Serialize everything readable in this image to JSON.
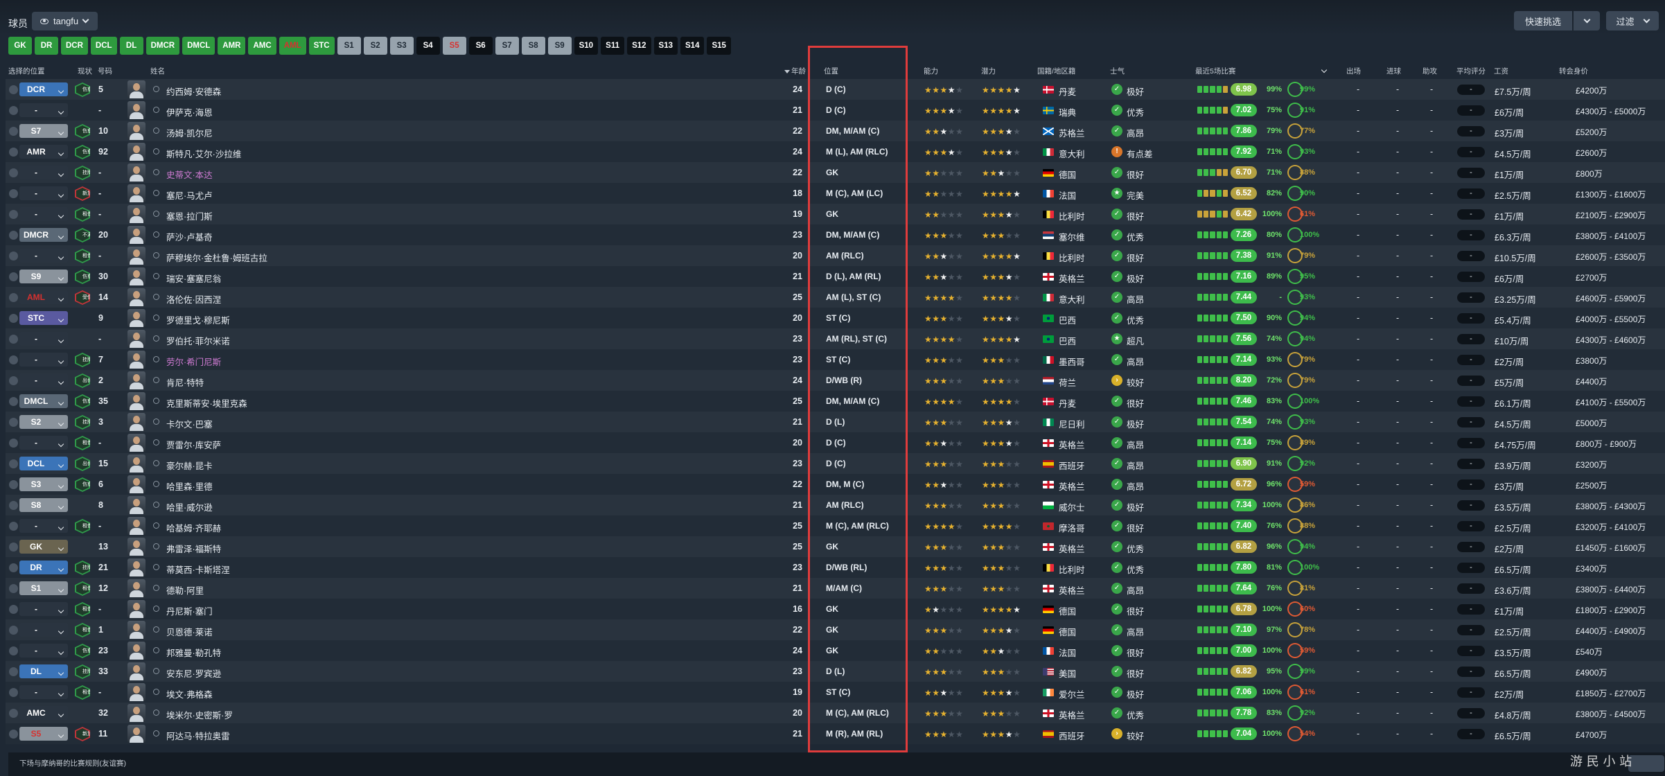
{
  "header": {
    "title": "球员",
    "view_name": "tangfu",
    "quick_pick": "快速挑选",
    "filter": "过滤"
  },
  "position_tabs": [
    {
      "label": "GK",
      "style": "g"
    },
    {
      "label": "DR",
      "style": "g"
    },
    {
      "label": "DCR",
      "style": "g"
    },
    {
      "label": "DCL",
      "style": "g"
    },
    {
      "label": "DL",
      "style": "g"
    },
    {
      "label": "DMCR",
      "style": "g"
    },
    {
      "label": "DMCL",
      "style": "g"
    },
    {
      "label": "AMR",
      "style": "g"
    },
    {
      "label": "AMC",
      "style": "g"
    },
    {
      "label": "AML",
      "style": "g"
    },
    {
      "label": "STC",
      "style": "g"
    },
    {
      "label": "S1",
      "style": "l"
    },
    {
      "label": "S2",
      "style": "l"
    },
    {
      "label": "S3",
      "style": "l"
    },
    {
      "label": "S4",
      "style": "d"
    },
    {
      "label": "S5",
      "style": "l"
    },
    {
      "label": "S6",
      "style": "d"
    },
    {
      "label": "S7",
      "style": "l"
    },
    {
      "label": "S8",
      "style": "l"
    },
    {
      "label": "S9",
      "style": "l"
    },
    {
      "label": "S10",
      "style": "d"
    },
    {
      "label": "S11",
      "style": "d"
    },
    {
      "label": "S12",
      "style": "d"
    },
    {
      "label": "S13",
      "style": "d"
    },
    {
      "label": "S14",
      "style": "d"
    },
    {
      "label": "S15",
      "style": "d"
    }
  ],
  "columns": {
    "selected_position": "选择的位置",
    "status": "现状",
    "number": "号码",
    "name": "姓名",
    "age": "年龄",
    "position": "位置",
    "ability": "能力",
    "potential": "潜力",
    "nation": "国籍/地区籍",
    "morale": "士气",
    "last5": "最近5场比赛",
    "appearances": "出场",
    "goals": "进球",
    "assists": "助攻",
    "avg_rating": "平均评分",
    "wage": "工资",
    "value": "转会身价"
  },
  "players": [
    {
      "sel": "DCR",
      "selColor": "#3b74b8",
      "status": "伤愈",
      "statusType": "green",
      "no": "5",
      "name": "约西姆·安德森",
      "age": "24",
      "pos": "D (C)",
      "ca": 3.5,
      "pa": 4.5,
      "flag": "dk",
      "nation": "丹麦",
      "mIcon": "✓",
      "mColor": "#3aa74a",
      "morale": "极好",
      "rating": "6.98",
      "rColor": "#7fc44b",
      "form": "gggga",
      "fit": "99%",
      "cond": "99%",
      "wage": "£7.5万/周",
      "value": "£4200万"
    },
    {
      "sel": "-",
      "selColor": "#2a3440",
      "status": "",
      "statusType": "none",
      "no": "-",
      "name": "伊萨克·海恩",
      "age": "21",
      "pos": "D (C)",
      "ca": 3.5,
      "pa": 4.5,
      "flag": "se",
      "nation": "瑞典",
      "mIcon": "✓",
      "mColor": "#3aa74a",
      "morale": "优秀",
      "rating": "7.02",
      "rColor": "#3dbb4c",
      "form": "gggga",
      "fit": "75%",
      "cond": "91%",
      "wage": "£6万/周",
      "value": "£4300万 - £5000万"
    },
    {
      "sel": "S7",
      "selColor": "#8a939c",
      "status": "伤愈",
      "statusType": "green",
      "no": "10",
      "name": "汤姆·凯尔尼",
      "age": "22",
      "pos": "DM, M/AM (C)",
      "ca": 2.5,
      "pa": 3.5,
      "flag": "sc",
      "nation": "苏格兰",
      "mIcon": "✓",
      "mColor": "#3aa74a",
      "morale": "高昂",
      "rating": "7.86",
      "rColor": "#3dbb4c",
      "form": "ggggg",
      "fit": "79%",
      "cond": "77%",
      "wage": "£3万/周",
      "value": "£5200万"
    },
    {
      "sel": "AMR",
      "selColor": "#2a3440",
      "status": "伤愈",
      "statusType": "green",
      "no": "92",
      "name": "斯特凡·艾尔·沙拉维",
      "age": "24",
      "pos": "M (L), AM (RLC)",
      "ca": 3.5,
      "pa": 3.5,
      "flag": "it",
      "nation": "意大利",
      "mIcon": "!",
      "mColor": "#d9762a",
      "morale": "有点差",
      "rating": "7.92",
      "rColor": "#3dbb4c",
      "form": "ggggg",
      "fit": "71%",
      "cond": "93%",
      "wage": "£4.5万/周",
      "value": "£2600万"
    },
    {
      "sel": "-",
      "selColor": "#2a3440",
      "status": "挂牌",
      "statusType": "green",
      "no": "-",
      "name": "史蒂文·本达",
      "age": "22",
      "pos": "GK",
      "ca": 2,
      "pa": 2.5,
      "flag": "de",
      "nation": "德国",
      "mIcon": "✓",
      "mColor": "#3aa74a",
      "morale": "很好",
      "rating": "6.70",
      "rColor": "#b3a042",
      "form": "gggaa",
      "fit": "71%",
      "cond": "88%",
      "wage": "£1万/周",
      "value": "£800万",
      "pink": true
    },
    {
      "sel": "-",
      "selColor": "#2a3440",
      "status": "新加入",
      "statusType": "red",
      "no": "-",
      "name": "塞尼·马尤卢",
      "age": "18",
      "pos": "M (C), AM (LC)",
      "ca": 2,
      "pa": 4.5,
      "flag": "fr",
      "nation": "法国",
      "mIcon": "★",
      "mColor": "#3aa74a",
      "morale": "完美",
      "rating": "6.52",
      "rColor": "#b3a042",
      "form": "gaaga",
      "fit": "82%",
      "cond": "90%",
      "wage": "£2.5万/周",
      "value": "£1300万 - £1600万"
    },
    {
      "sel": "-",
      "selColor": "#2a3440",
      "status": "租借",
      "statusType": "green",
      "no": "-",
      "name": "塞恩·拉门斯",
      "age": "19",
      "pos": "GK",
      "ca": 2,
      "pa": 3.5,
      "flag": "be",
      "nation": "比利时",
      "mIcon": "✓",
      "mColor": "#3aa74a",
      "morale": "很好",
      "rating": "6.42",
      "rColor": "#b3a042",
      "form": "aaaga",
      "fit": "100%",
      "cond": "61%",
      "wage": "£1万/周",
      "value": "£2100万 - £2900万"
    },
    {
      "sel": "DMCR",
      "selColor": "#5a6876",
      "status": "不满",
      "statusType": "green",
      "no": "20",
      "name": "萨沙·卢基奇",
      "age": "23",
      "pos": "DM, M/AM (C)",
      "ca": 3,
      "pa": 3,
      "flag": "rs",
      "nation": "塞尔维",
      "mIcon": "✓",
      "mColor": "#3aa74a",
      "morale": "优秀",
      "rating": "7.26",
      "rColor": "#3dbb4c",
      "form": "ggggg",
      "fit": "80%",
      "cond": "100%",
      "wage": "£6.3万/周",
      "value": "£3800万 - £4100万"
    },
    {
      "sel": "-",
      "selColor": "#2a3440",
      "status": "租借",
      "statusType": "green",
      "no": "-",
      "name": "萨穆埃尔·金杜鲁·姆班古拉",
      "age": "20",
      "pos": "AM (RLC)",
      "ca": 2.5,
      "pa": 4.5,
      "flag": "be",
      "nation": "比利时",
      "mIcon": "✓",
      "mColor": "#3aa74a",
      "morale": "很好",
      "rating": "7.38",
      "rColor": "#3dbb4c",
      "form": "ggggg",
      "fit": "91%",
      "cond": "79%",
      "wage": "£10.5万/周",
      "value": "£2600万 - £3500万"
    },
    {
      "sel": "S9",
      "selColor": "#8a939c",
      "status": "伤愈",
      "statusType": "green",
      "no": "30",
      "name": "瑞安·塞塞尼翁",
      "age": "21",
      "pos": "D (L), AM (RL)",
      "ca": 2.5,
      "pa": 3.5,
      "flag": "en",
      "nation": "英格兰",
      "mIcon": "✓",
      "mColor": "#3aa74a",
      "morale": "极好",
      "rating": "7.16",
      "rColor": "#3dbb4c",
      "form": "ggggg",
      "fit": "89%",
      "cond": "95%",
      "wage": "£6万/周",
      "value": "£2700万"
    },
    {
      "sel": "AML",
      "selColor": "#2a3440",
      "status": "受伤",
      "statusType": "red",
      "no": "14",
      "name": "洛伦佐·因西涅",
      "age": "25",
      "pos": "AM (L), ST (C)",
      "ca": 4,
      "pa": 4,
      "flag": "it",
      "nation": "意大利",
      "mIcon": "✓",
      "mColor": "#3aa74a",
      "morale": "高昂",
      "rating": "7.44",
      "rColor": "#3dbb4c",
      "form": "ggggg",
      "fit": "-",
      "cond": "93%",
      "wage": "£3.25万/周",
      "value": "£4600万 - £5900万",
      "selRed": true
    },
    {
      "sel": "STC",
      "selColor": "#5a5aa0",
      "status": "",
      "statusType": "none",
      "no": "9",
      "name": "罗德里戈·穆尼斯",
      "age": "20",
      "pos": "ST (C)",
      "ca": 3,
      "pa": 3.5,
      "flag": "br",
      "nation": "巴西",
      "mIcon": "✓",
      "mColor": "#3aa74a",
      "morale": "优秀",
      "rating": "7.50",
      "rColor": "#3dbb4c",
      "form": "ggggg",
      "fit": "90%",
      "cond": "94%",
      "wage": "£5.4万/周",
      "value": "£4000万 - £5500万"
    },
    {
      "sel": "-",
      "selColor": "#2a3440",
      "status": "",
      "statusType": "none",
      "no": "-",
      "name": "罗伯托·菲尔米诺",
      "age": "23",
      "pos": "AM (RL), ST (C)",
      "ca": 4,
      "pa": 4.5,
      "flag": "br",
      "nation": "巴西",
      "mIcon": "★",
      "mColor": "#3aa74a",
      "morale": "超凡",
      "rating": "7.56",
      "rColor": "#3dbb4c",
      "form": "ggggg",
      "fit": "74%",
      "cond": "94%",
      "wage": "£10万/周",
      "value": "£4300万 - £4600万"
    },
    {
      "sel": "-",
      "selColor": "#2a3440",
      "status": "挂牌",
      "statusType": "green",
      "no": "7",
      "name": "劳尔·希门尼斯",
      "age": "23",
      "pos": "ST (C)",
      "ca": 3,
      "pa": 3,
      "flag": "mx",
      "nation": "墨西哥",
      "mIcon": "✓",
      "mColor": "#3aa74a",
      "morale": "高昂",
      "rating": "7.14",
      "rColor": "#3dbb4c",
      "form": "ggggg",
      "fit": "93%",
      "cond": "79%",
      "wage": "£2万/周",
      "value": "£3800万",
      "pink": true
    },
    {
      "sel": "-",
      "selColor": "#2a3440",
      "status": "出价",
      "statusType": "green",
      "no": "2",
      "name": "肯尼·特特",
      "age": "24",
      "pos": "D/WB (R)",
      "ca": 3,
      "pa": 3,
      "flag": "nl",
      "nation": "荷兰",
      "mIcon": "›",
      "mColor": "#d9b12a",
      "morale": "较好",
      "rating": "8.20",
      "rColor": "#3dbb4c",
      "form": "ggggg",
      "fit": "72%",
      "cond": "79%",
      "wage": "£5万/周",
      "value": "£4400万"
    },
    {
      "sel": "DMCL",
      "selColor": "#5a6876",
      "status": "伤愈",
      "statusType": "green",
      "no": "35",
      "name": "克里斯蒂安·埃里克森",
      "age": "25",
      "pos": "DM, M/AM (C)",
      "ca": 4,
      "pa": 4,
      "flag": "dk",
      "nation": "丹麦",
      "mIcon": "✓",
      "mColor": "#3aa74a",
      "morale": "很好",
      "rating": "7.46",
      "rColor": "#3dbb4c",
      "form": "ggggg",
      "fit": "83%",
      "cond": "100%",
      "wage": "£6.1万/周",
      "value": "£4100万 - £5500万"
    },
    {
      "sel": "S2",
      "selColor": "#8a939c",
      "status": "挂牌",
      "statusType": "green",
      "no": "3",
      "name": "卡尔文·巴塞",
      "age": "21",
      "pos": "D (L)",
      "ca": 3,
      "pa": 3.5,
      "flag": "ng",
      "nation": "尼日利",
      "mIcon": "✓",
      "mColor": "#3aa74a",
      "morale": "极好",
      "rating": "7.54",
      "rColor": "#3dbb4c",
      "form": "ggggg",
      "fit": "74%",
      "cond": "93%",
      "wage": "£4.5万/周",
      "value": "£5000万"
    },
    {
      "sel": "-",
      "selColor": "#2a3440",
      "status": "租借",
      "statusType": "green",
      "no": "-",
      "name": "贾雷尔·库安萨",
      "age": "20",
      "pos": "D (C)",
      "ca": 2.5,
      "pa": 3.5,
      "flag": "en",
      "nation": "英格兰",
      "mIcon": "✓",
      "mColor": "#3aa74a",
      "morale": "高昂",
      "rating": "7.14",
      "rColor": "#3dbb4c",
      "form": "ggggg",
      "fit": "75%",
      "cond": "89%",
      "wage": "£4.75万/周",
      "value": "£800万 - £900万"
    },
    {
      "sel": "DCL",
      "selColor": "#3b74b8",
      "status": "出价",
      "statusType": "green",
      "no": "15",
      "name": "豪尔赫·昆卡",
      "age": "23",
      "pos": "D (C)",
      "ca": 3,
      "pa": 3,
      "flag": "es",
      "nation": "西班牙",
      "mIcon": "✓",
      "mColor": "#3aa74a",
      "morale": "高昂",
      "rating": "6.90",
      "rColor": "#7fc44b",
      "form": "ggggg",
      "fit": "91%",
      "cond": "92%",
      "wage": "£3.9万/周",
      "value": "£3200万"
    },
    {
      "sel": "S3",
      "selColor": "#8a939c",
      "status": "伤愈",
      "statusType": "green",
      "no": "6",
      "name": "哈里森·里德",
      "age": "22",
      "pos": "DM, M (C)",
      "ca": 2.5,
      "pa": 3,
      "flag": "en",
      "nation": "英格兰",
      "mIcon": "✓",
      "mColor": "#3aa74a",
      "morale": "高昂",
      "rating": "6.72",
      "rColor": "#b3a042",
      "form": "ggggg",
      "fit": "96%",
      "cond": "59%",
      "wage": "£3万/周",
      "value": "£2500万"
    },
    {
      "sel": "S8",
      "selColor": "#8a939c",
      "status": "",
      "statusType": "none",
      "no": "8",
      "name": "哈里·威尔逊",
      "age": "21",
      "pos": "AM (RLC)",
      "ca": 3,
      "pa": 3,
      "flag": "wa",
      "nation": "威尔士",
      "mIcon": "✓",
      "mColor": "#3aa74a",
      "morale": "极好",
      "rating": "7.34",
      "rColor": "#3dbb4c",
      "form": "ggggg",
      "fit": "100%",
      "cond": "86%",
      "wage": "£3.5万/周",
      "value": "£3800万 - £4300万"
    },
    {
      "sel": "-",
      "selColor": "#2a3440",
      "status": "租借",
      "statusType": "green",
      "no": "-",
      "name": "哈基姆·齐耶赫",
      "age": "25",
      "pos": "M (C), AM (RLC)",
      "ca": 4,
      "pa": 4,
      "flag": "ma",
      "nation": "摩洛哥",
      "mIcon": "✓",
      "mColor": "#3aa74a",
      "morale": "很好",
      "rating": "7.40",
      "rColor": "#3dbb4c",
      "form": "ggggg",
      "fit": "76%",
      "cond": "88%",
      "wage": "£2.5万/周",
      "value": "£3200万 - £4100万"
    },
    {
      "sel": "GK",
      "selColor": "#6a6450",
      "status": "",
      "statusType": "none",
      "no": "13",
      "name": "弗雷泽·福斯特",
      "age": "25",
      "pos": "GK",
      "ca": 3,
      "pa": 3,
      "flag": "en",
      "nation": "英格兰",
      "mIcon": "✓",
      "mColor": "#3aa74a",
      "morale": "优秀",
      "rating": "6.82",
      "rColor": "#b3a042",
      "form": "ggggg",
      "fit": "96%",
      "cond": "94%",
      "wage": "£2万/周",
      "value": "£1450万 - £1600万"
    },
    {
      "sel": "DR",
      "selColor": "#3b74b8",
      "status": "挂牌",
      "statusType": "green",
      "no": "21",
      "name": "蒂莫西·卡斯塔涅",
      "age": "23",
      "pos": "D/WB (RL)",
      "ca": 3,
      "pa": 3,
      "flag": "be",
      "nation": "比利时",
      "mIcon": "✓",
      "mColor": "#3aa74a",
      "morale": "优秀",
      "rating": "7.80",
      "rColor": "#3dbb4c",
      "form": "ggggg",
      "fit": "81%",
      "cond": "100%",
      "wage": "£6.5万/周",
      "value": "£3400万"
    },
    {
      "sel": "S1",
      "selColor": "#8a939c",
      "status": "租借",
      "statusType": "green",
      "no": "12",
      "name": "德勒·阿里",
      "age": "21",
      "pos": "M/AM (C)",
      "ca": 3,
      "pa": 3,
      "flag": "en",
      "nation": "英格兰",
      "mIcon": "✓",
      "mColor": "#3aa74a",
      "morale": "高昂",
      "rating": "7.64",
      "rColor": "#3dbb4c",
      "form": "ggggg",
      "fit": "76%",
      "cond": "81%",
      "wage": "£3.6万/周",
      "value": "£3800万 - £4400万"
    },
    {
      "sel": "-",
      "selColor": "#2a3440",
      "status": "租借",
      "statusType": "green",
      "no": "-",
      "name": "丹尼斯·塞门",
      "age": "16",
      "pos": "GK",
      "ca": 1.5,
      "pa": 4.5,
      "flag": "de",
      "nation": "德国",
      "mIcon": "✓",
      "mColor": "#3aa74a",
      "morale": "很好",
      "rating": "6.78",
      "rColor": "#b3a042",
      "form": "ggggg",
      "fit": "100%",
      "cond": "60%",
      "wage": "£1万/周",
      "value": "£1800万 - £2900万"
    },
    {
      "sel": "-",
      "selColor": "#2a3440",
      "status": "租借",
      "statusType": "green",
      "no": "1",
      "name": "贝恩德·莱诺",
      "age": "22",
      "pos": "GK",
      "ca": 3,
      "pa": 3.5,
      "flag": "de",
      "nation": "德国",
      "mIcon": "✓",
      "mColor": "#3aa74a",
      "morale": "高昂",
      "rating": "7.10",
      "rColor": "#3dbb4c",
      "form": "ggggg",
      "fit": "97%",
      "cond": "78%",
      "wage": "£2.5万/周",
      "value": "£4400万 - £4900万"
    },
    {
      "sel": "-",
      "selColor": "#2a3440",
      "status": "伤愈",
      "statusType": "green",
      "no": "23",
      "name": "邦雅曼·勒孔特",
      "age": "24",
      "pos": "GK",
      "ca": 2,
      "pa": 2.5,
      "flag": "fr",
      "nation": "法国",
      "mIcon": "✓",
      "mColor": "#3aa74a",
      "morale": "很好",
      "rating": "7.00",
      "rColor": "#3dbb4c",
      "form": "ggggg",
      "fit": "100%",
      "cond": "59%",
      "wage": "£3.5万/周",
      "value": "£540万"
    },
    {
      "sel": "DL",
      "selColor": "#3b74b8",
      "status": "挂牌",
      "statusType": "green",
      "no": "33",
      "name": "安东尼·罗宾逊",
      "age": "23",
      "pos": "D (L)",
      "ca": 3,
      "pa": 3,
      "flag": "us",
      "nation": "美国",
      "mIcon": "✓",
      "mColor": "#3aa74a",
      "morale": "很好",
      "rating": "6.82",
      "rColor": "#b3a042",
      "form": "ggggg",
      "fit": "95%",
      "cond": "99%",
      "wage": "£6.5万/周",
      "value": "£4900万"
    },
    {
      "sel": "-",
      "selColor": "#2a3440",
      "status": "租借",
      "statusType": "green",
      "no": "-",
      "name": "埃文·弗格森",
      "age": "19",
      "pos": "ST (C)",
      "ca": 2.5,
      "pa": 3.5,
      "flag": "ie",
      "nation": "爱尔兰",
      "mIcon": "✓",
      "mColor": "#3aa74a",
      "morale": "极好",
      "rating": "7.06",
      "rColor": "#3dbb4c",
      "form": "ggggg",
      "fit": "100%",
      "cond": "61%",
      "wage": "£2万/周",
      "value": "£1850万 - £2700万"
    },
    {
      "sel": "AMC",
      "selColor": "#2a3440",
      "status": "",
      "statusType": "none",
      "no": "32",
      "name": "埃米尔·史密斯·罗",
      "age": "20",
      "pos": "M (C), AM (RLC)",
      "ca": 3,
      "pa": 3,
      "flag": "en",
      "nation": "英格兰",
      "mIcon": "✓",
      "mColor": "#3aa74a",
      "morale": "优秀",
      "rating": "7.78",
      "rColor": "#3dbb4c",
      "form": "ggggg",
      "fit": "83%",
      "cond": "92%",
      "wage": "£4.8万/周",
      "value": "£3800万 - £4500万"
    },
    {
      "sel": "S5",
      "selColor": "#8a939c",
      "status": "新加入",
      "statusType": "red",
      "no": "11",
      "name": "阿达马·特拉奥雷",
      "age": "21",
      "pos": "M (R), AM (RL)",
      "ca": 3,
      "pa": 3.5,
      "flag": "es",
      "nation": "西班牙",
      "mIcon": "›",
      "mColor": "#d9b12a",
      "morale": "较好",
      "rating": "7.04",
      "rColor": "#3dbb4c",
      "form": "ggggg",
      "fit": "100%",
      "cond": "54%",
      "wage": "£6.5万/周",
      "value": "£4700万",
      "selRed": true
    }
  ],
  "footer": {
    "text": "下场与摩纳哥的比赛规则(友谊赛)",
    "watermark": "游 民 小 站"
  },
  "colors": {
    "green_tab": "#2e9a3e",
    "highlight": "#e03c3c",
    "pink_name": "#cf7bd3"
  }
}
